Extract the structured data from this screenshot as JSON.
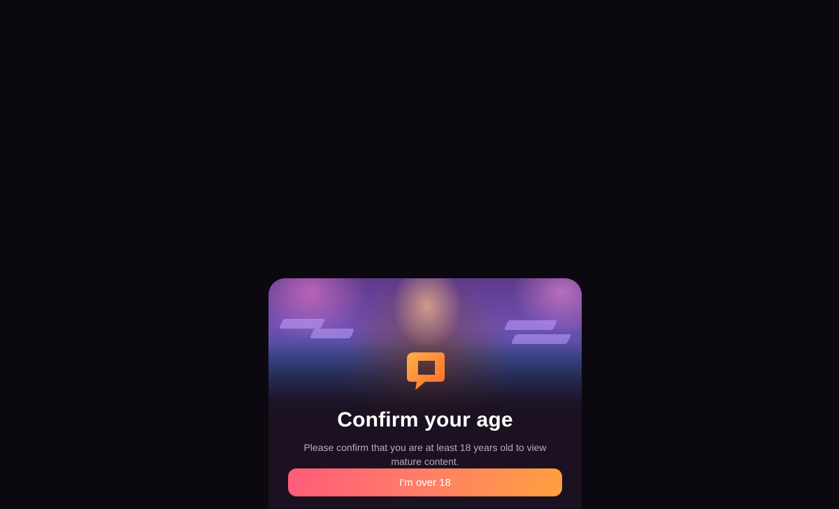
{
  "modal": {
    "title": "Confirm your age",
    "message": "Please confirm that you are at least 18 years old to view mature content.",
    "confirm_label": "I'm over 18",
    "hero_image": "woman-by-pool-at-night",
    "logo_icon": "chat-bubble-logo-icon"
  },
  "colors": {
    "background": "#0c080f",
    "modal_background": "#1b1120",
    "button_gradient_start": "#ff5c7a",
    "button_gradient_end": "#ff9f3e",
    "title": "#ffffff",
    "message": "#b6aebd"
  }
}
